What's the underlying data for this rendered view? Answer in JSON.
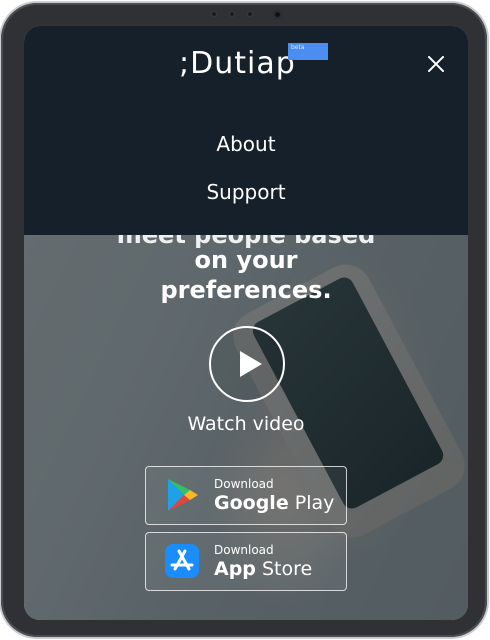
{
  "brand": {
    "logo": ";Dutiap",
    "badge": "beta"
  },
  "menu": {
    "items": [
      "About",
      "Support"
    ]
  },
  "hero": {
    "headline_cut": "meet people based",
    "headline_line1": "on your",
    "headline_line2": "preferences."
  },
  "video": {
    "label": "Watch video"
  },
  "stores": {
    "google": {
      "small": "Download",
      "bold": "Google",
      "rest": " Play"
    },
    "apple": {
      "small": "Download",
      "bold": "App",
      "rest": " Store"
    }
  },
  "icons": {
    "close": "close-icon",
    "play": "play-icon",
    "google_play": "google-play-icon",
    "app_store": "app-store-icon"
  },
  "colors": {
    "menu_bg": "#16202a",
    "beta_badge": "#4b8df0",
    "app_store_blue": "#1a8dfb"
  }
}
